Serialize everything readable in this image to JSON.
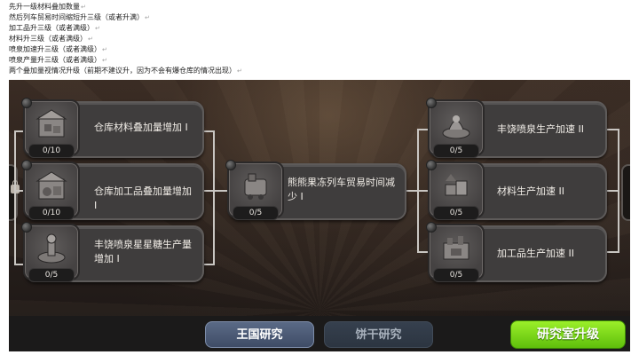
{
  "notes": [
    "先升一级材料叠加数量",
    "然后列车贸易时间缩短升三级（或者升满）",
    "加工品升三级（或者满级）",
    "材料升三级（或者满级）",
    "喷泉加速升三级（或者满级）",
    "喷泉产量升三级（或者满级）",
    "两个叠加量视情况升级（前期不建议升，因为不会有爆仓库的情况出现）"
  ],
  "return_mark": "↵",
  "research": {
    "left": [
      {
        "label": "仓库材料叠加量增加 I",
        "progress": "0/10",
        "icon": "warehouse-materials-icon"
      },
      {
        "label": "仓库加工品叠加量增加 I",
        "progress": "0/10",
        "icon": "warehouse-goods-icon"
      },
      {
        "label": "丰饶喷泉星星糖生产量增加 I",
        "progress": "0/5",
        "icon": "fountain-star-jelly-icon"
      }
    ],
    "center": {
      "label": "熊熊果冻列车贸易时间减少 I",
      "progress": "0/5",
      "icon": "train-icon"
    },
    "right": [
      {
        "label": "丰饶喷泉生产加速 II",
        "progress": "0/5",
        "icon": "fountain-speed-icon"
      },
      {
        "label": "材料生产加速 II",
        "progress": "0/5",
        "icon": "materials-speed-icon"
      },
      {
        "label": "加工品生产加速 II",
        "progress": "0/5",
        "icon": "goods-speed-icon"
      }
    ]
  },
  "tabs": {
    "kingdom": "王国研究",
    "cookie": "饼干研究",
    "upgrade": "研究室升级"
  },
  "colors": {
    "upgrade_green": "#6fd014",
    "active_tab": "#4a5874",
    "card_bg": "#3f3d3d"
  }
}
